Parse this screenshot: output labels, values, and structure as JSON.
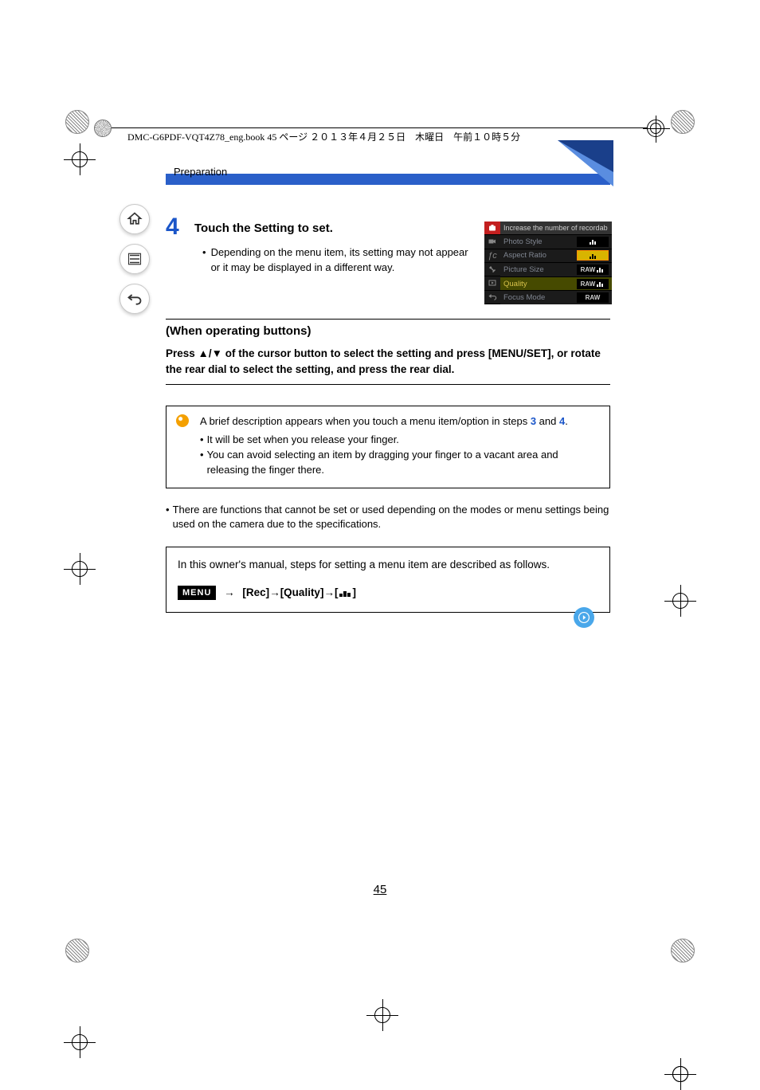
{
  "meta_header": "DMC-G6PDF-VQT4Z78_eng.book  45 ページ  ２０１３年４月２５日　木曜日　午前１０時５分",
  "chapter": "Preparation",
  "step": {
    "number": "4",
    "title": "Touch the Setting to set.",
    "bullet": "Depending on the menu item, its setting may not appear or it may be displayed in a different way."
  },
  "subhead": "(When operating buttons)",
  "press_text_1": "Press ",
  "press_text_2": " of the cursor button to select the setting and press [MENU/SET], or rotate the rear dial to select the setting, and press the rear dial.",
  "up_down": "▲/▼",
  "note": {
    "line1_a": "A brief description appears when you touch a menu item/option in steps ",
    "three": "3",
    "line1_b": " and ",
    "four": "4",
    "line1_c": ".",
    "sub1": "It will be set when you release your finger.",
    "sub2": "You can avoid selecting an item by dragging your finger to a vacant area and releasing the finger there."
  },
  "after_note": "There are functions that cannot be set or used depending on the modes or menu settings being used on the camera due to the specifications.",
  "summary": {
    "intro": "In this owner's manual, steps for setting a menu item are described as follows.",
    "menu_label": "MENU",
    "path1": "[Rec]",
    "path2": "[Quality]"
  },
  "camera": {
    "tooltip": "Increase the number of recordab",
    "rows": [
      {
        "label": "Photo Style",
        "value": ""
      },
      {
        "label": "Aspect Ratio",
        "value": ""
      },
      {
        "label": "Picture Size",
        "value": "RAW"
      },
      {
        "label": "Quality",
        "value": "RAW"
      },
      {
        "label": "Focus Mode",
        "value": "RAW"
      }
    ]
  },
  "page_number": "45"
}
